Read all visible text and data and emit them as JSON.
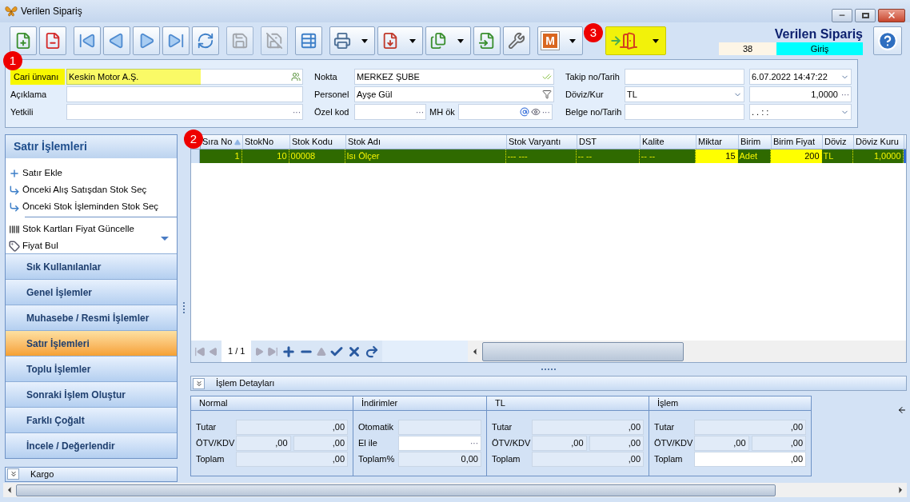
{
  "window": {
    "title": "Verilen Sipariş"
  },
  "toolbar": [
    [
      {
        "kind": "new",
        "disabled": false,
        "dropdown": false,
        "highlighted": false
      },
      {
        "kind": "delete",
        "disabled": false,
        "dropdown": false,
        "highlighted": false
      }
    ],
    [
      {
        "kind": "first",
        "disabled": false,
        "dropdown": false,
        "highlighted": false
      },
      {
        "kind": "prev",
        "disabled": false,
        "dropdown": false,
        "highlighted": false
      },
      {
        "kind": "next",
        "disabled": false,
        "dropdown": false,
        "highlighted": false
      },
      {
        "kind": "last",
        "disabled": false,
        "dropdown": false,
        "highlighted": false
      },
      {
        "kind": "refresh",
        "disabled": false,
        "dropdown": false,
        "highlighted": false
      }
    ],
    [
      {
        "kind": "save",
        "disabled": true,
        "dropdown": false,
        "highlighted": false
      }
    ],
    [
      {
        "kind": "save-cancel",
        "disabled": true,
        "dropdown": false,
        "highlighted": false
      }
    ],
    [
      {
        "kind": "report",
        "disabled": false,
        "dropdown": false,
        "highlighted": false
      }
    ],
    [
      {
        "kind": "print",
        "disabled": false,
        "dropdown": true,
        "highlighted": false
      },
      {
        "kind": "pdf",
        "disabled": false,
        "dropdown": true,
        "highlighted": false
      },
      {
        "kind": "copy",
        "disabled": false,
        "dropdown": true,
        "highlighted": false
      },
      {
        "kind": "import",
        "disabled": false,
        "dropdown": false,
        "highlighted": false
      },
      {
        "kind": "tools",
        "disabled": false,
        "dropdown": false,
        "highlighted": false
      }
    ],
    [
      {
        "kind": "letter",
        "label": "M",
        "disabled": false,
        "dropdown": true,
        "highlighted": false
      }
    ],
    [
      {
        "kind": "exit",
        "disabled": false,
        "dropdown": true,
        "highlighted": true
      }
    ]
  ],
  "document": {
    "title": "Verilen Sipariş",
    "number": "38",
    "status": "Giriş"
  },
  "form": [
    [
      {
        "label": "Cari ünvanı",
        "highlighted": true,
        "inputs": [
          {
            "kind": "people",
            "value": "Keskin Motor A.Ş."
          }
        ]
      },
      {
        "label": "Açıklama",
        "highlighted": false,
        "inputs": [
          {
            "kind": "text"
          }
        ]
      },
      {
        "label": "Yetkili",
        "highlighted": false,
        "inputs": [
          {
            "kind": "ellipsis",
            "button": "···"
          }
        ]
      }
    ],
    [
      {
        "label": "Nokta",
        "highlighted": false,
        "inputs": [
          {
            "kind": "check",
            "value": "MERKEZ ŞUBE"
          }
        ]
      },
      {
        "label": "Personel",
        "highlighted": false,
        "inputs": [
          {
            "kind": "filter",
            "value": "Ayşe Gül"
          }
        ]
      },
      {
        "label": "Özel kod",
        "highlighted": false,
        "inputs": [
          {
            "kind": "ellipsis",
            "button": "···"
          },
          {
            "kind": "label",
            "value": "MH ök"
          },
          {
            "kind": "email",
            "button": "···"
          }
        ]
      }
    ],
    [
      {
        "label": "Takip no/Tarih",
        "highlighted": false,
        "inputs": [
          {
            "kind": "text"
          },
          {
            "kind": "dropdown",
            "value": "6.07.2022 14:47:22"
          }
        ]
      },
      {
        "label": "Döviz/Kur",
        "highlighted": false,
        "inputs": [
          {
            "kind": "dropdown",
            "value": "TL"
          },
          {
            "kind": "number",
            "value": "1,0000",
            "button": "···"
          }
        ]
      },
      {
        "label": "Belge no/Tarih",
        "highlighted": false,
        "inputs": [
          {
            "kind": "text"
          },
          {
            "kind": "dropdown",
            "value": ".  .        :  :"
          }
        ]
      }
    ]
  ],
  "side_panel": {
    "title": "Satır İşlemleri",
    "actions": [
      [
        {
          "kind": "add",
          "label": "Satır Ekle"
        },
        {
          "kind": "return",
          "label": "Önceki Alış Satışdan Stok Seç"
        },
        {
          "kind": "return",
          "label": "Önceki Stok İşleminden Stok Seç"
        }
      ],
      [
        {
          "kind": "barcode",
          "label": "Stok Kartları Fiyat Güncelle"
        },
        {
          "kind": "tag",
          "label": "Fiyat Bul"
        }
      ]
    ],
    "groups": [
      {
        "label": "Sık Kullanılanlar",
        "selected": false
      },
      {
        "label": "Genel İşlemler",
        "selected": false
      },
      {
        "label": "Muhasebe / Resmi İşlemler",
        "selected": false
      },
      {
        "label": "Satır İşlemleri",
        "selected": true
      },
      {
        "label": "Toplu İşlemler",
        "selected": false
      },
      {
        "label": "Sonraki İşlem Oluştur",
        "selected": false
      },
      {
        "label": "Farklı Çoğalt",
        "selected": false
      },
      {
        "label": "İncele / Değerlendir",
        "selected": false
      }
    ],
    "footer": {
      "label": "Kargo",
      "expanded": false
    }
  },
  "grid": {
    "columns": [
      {
        "label": "Sıra No",
        "kind": "number",
        "sorted": true
      },
      {
        "label": "StokNo",
        "kind": "number",
        "sorted": false
      },
      {
        "label": "Stok Kodu",
        "kind": "text",
        "sorted": false
      },
      {
        "label": "Stok Adı",
        "kind": "text",
        "sorted": false
      },
      {
        "label": "Stok Varyantı",
        "kind": "text",
        "sorted": false
      },
      {
        "label": "DST",
        "kind": "text",
        "sorted": false
      },
      {
        "label": "Kalite",
        "kind": "text",
        "sorted": false
      },
      {
        "label": "Miktar",
        "kind": "number",
        "sorted": false
      },
      {
        "label": "Birim",
        "kind": "text",
        "sorted": false
      },
      {
        "label": "Birim Fiyat",
        "kind": "number",
        "sorted": false
      },
      {
        "label": "Döviz",
        "kind": "text",
        "sorted": false
      },
      {
        "label": "Döviz Kuru",
        "kind": "number",
        "sorted": false
      }
    ],
    "rows": [
      {
        "selected": true,
        "cells": [
          {
            "value": "1",
            "highlighted": false
          },
          {
            "value": "10",
            "highlighted": false
          },
          {
            "value": "00008",
            "highlighted": false
          },
          {
            "value": "Isı Ölçer",
            "highlighted": false
          },
          {
            "value": "--- ---",
            "highlighted": false
          },
          {
            "value": "-- --",
            "highlighted": false
          },
          {
            "value": "-- --",
            "highlighted": false
          },
          {
            "value": "15",
            "highlighted": true
          },
          {
            "value": "Adet",
            "highlighted": false
          },
          {
            "value": "200",
            "highlighted": true
          },
          {
            "value": "TL",
            "highlighted": false
          },
          {
            "value": "1,0000",
            "highlighted": false
          }
        ]
      }
    ],
    "pager": "1 / 1"
  },
  "details": {
    "title": "İşlem Detayları",
    "expanded": true,
    "panels": [
      {
        "title": "Normal",
        "rows": [
          {
            "label": "Tutar",
            "values": [
              {
                "value": ",00",
                "editable": false
              }
            ]
          },
          {
            "label": "ÖTV/KDV",
            "values": [
              {
                "value": ",00",
                "editable": false
              },
              {
                "value": ",00",
                "editable": false
              }
            ]
          },
          {
            "label": "Toplam",
            "values": [
              {
                "value": ",00",
                "editable": false
              }
            ]
          }
        ]
      },
      {
        "title": "İndirimler",
        "rows": [
          {
            "label": "Otomatik",
            "values": [
              {
                "editable": false
              }
            ]
          },
          {
            "label": "El ile",
            "values": [
              {
                "editable": true,
                "button": "···"
              }
            ]
          },
          {
            "label": "Toplam%",
            "values": [
              {
                "value": "0,00",
                "editable": false
              }
            ]
          }
        ]
      },
      {
        "title": "TL",
        "rows": [
          {
            "label": "Tutar",
            "values": [
              {
                "value": ",00",
                "editable": false
              }
            ]
          },
          {
            "label": "ÖTV/KDV",
            "values": [
              {
                "value": ",00",
                "editable": false
              },
              {
                "value": ",00",
                "editable": false
              }
            ]
          },
          {
            "label": "Toplam",
            "values": [
              {
                "value": ",00",
                "editable": false
              }
            ]
          }
        ]
      },
      {
        "title": "İşlem",
        "rows": [
          {
            "label": "Tutar",
            "values": [
              {
                "value": ",00",
                "editable": false
              }
            ]
          },
          {
            "label": "ÖTV/KDV",
            "values": [
              {
                "value": ",00",
                "editable": false
              },
              {
                "value": ",00",
                "editable": false
              }
            ]
          },
          {
            "label": "Toplam",
            "values": [
              {
                "value": ",00",
                "editable": true
              }
            ]
          }
        ]
      }
    ]
  },
  "annotations": [
    {
      "label": "1"
    },
    {
      "label": "2"
    },
    {
      "label": "3"
    }
  ]
}
